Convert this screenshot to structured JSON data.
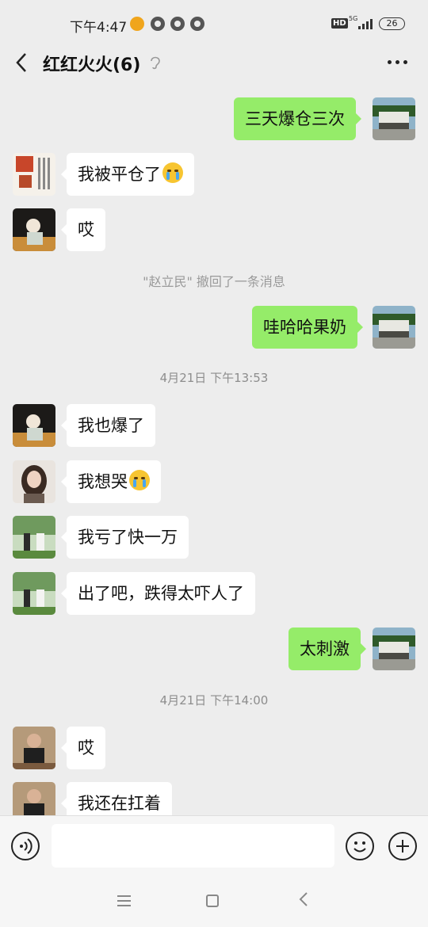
{
  "status_bar": {
    "time": "下午4:47",
    "network": "5G",
    "hd_badge": "HD",
    "battery": "26"
  },
  "header": {
    "title": "红红火火(6)",
    "back_icon": "chevron-left-icon",
    "more_icon": "more-dots-icon",
    "ear_icon": "ear-icon"
  },
  "messages": [
    {
      "direction": "out",
      "text": "三天爆仓三次"
    },
    {
      "direction": "in",
      "text": "我被平仓了",
      "emoji": "crying-face"
    },
    {
      "direction": "in",
      "text": "哎"
    },
    {
      "direction": "out",
      "text": "哇哈哈果奶"
    },
    {
      "direction": "in",
      "text": "我也爆了"
    },
    {
      "direction": "in",
      "text": "我想哭",
      "emoji": "loudly-crying-face"
    },
    {
      "direction": "in",
      "text": "我亏了快一万"
    },
    {
      "direction": "in",
      "text": "出了吧，跌得太吓人了"
    },
    {
      "direction": "out",
      "text": "太刺激"
    },
    {
      "direction": "in",
      "text": "哎"
    },
    {
      "direction": "in",
      "text": "我还在扛着"
    }
  ],
  "system_notes": {
    "recall": "\"赵立民\" 撤回了一条消息"
  },
  "timestamps": [
    "4月21日 下午13:53",
    "4月21日 下午14:00"
  ],
  "input_bar": {
    "placeholder": "",
    "voice_icon": "voice-icon",
    "emoji_icon": "emoji-icon",
    "plus_icon": "plus-icon"
  },
  "nav": {
    "menu_icon": "menu-icon",
    "home_icon": "home-icon",
    "back_icon": "back-icon"
  },
  "colors": {
    "outgoing_bubble": "#95ec69",
    "incoming_bubble": "#ffffff",
    "background": "#ededed"
  }
}
